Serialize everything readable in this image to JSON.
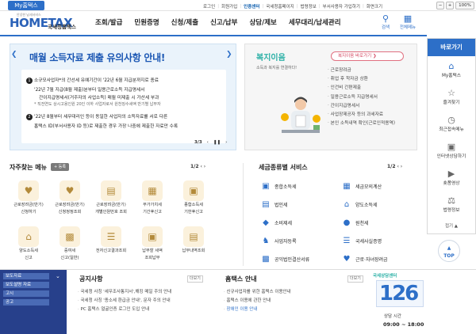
{
  "topbar": {
    "mytab_label": "My홈택스",
    "links": [
      "로그인",
      "회원가입",
      "인증센터",
      "국세청홈페이지",
      "법령정보",
      "부서사용자 가입하기",
      "화면크기"
    ],
    "zoom": "100%"
  },
  "header": {
    "logo_sub": "안녕한 납세서비스",
    "logo_main": "HOMETAX",
    "logo_kor": "국세청홈택스",
    "gnb": [
      "조회/발급",
      "민원증명",
      "신청/제출",
      "신고/납부",
      "상담/제보",
      "세무대리/납세관리"
    ],
    "search_label": "검색",
    "allmenu_label": "전체메뉴"
  },
  "banner": {
    "title": "매월 소득자료 제출 유의사항 안내!",
    "line1": "소규모사업자*의 간선세 유예기간이 '22년 6월 지급분까지로 종료",
    "line2": "'22년 7월 지급(8월 제출)분부터 일용근로소득 지급명세서",
    "line3": "간이지급명세서(거주자의 사업소득) 매월 미제출 시 가산세 부과",
    "line4": "* 직전연도 상시고용인원 20인 이하 사업자로서 원천징수세액 반기별 납부자",
    "line5": "'22년 8월부터 세무대리인 등이 동일한 사업자의 소득자료를 서로 다른",
    "line6": "홈택스 ID(부서사용자 ID 등)로 제출한 경우 가장 나중에 제출한 자료만 수록",
    "page": "3/3"
  },
  "welfare": {
    "title": "복지이음",
    "desc1": "소득과 복지를 연결하다!",
    "desc2": "",
    "button": "복지이음 바로가기",
    "items": [
      "근로장려금",
      "취업 후 학자금 상환",
      "인건비 간편제출",
      "일용근로소득 지급명세서",
      "간이지급명세서",
      "사업장제공자 등의 과세자료",
      "본인 소득내역 확인(근로인적용역)"
    ]
  },
  "quick": {
    "title": "바로가기",
    "items": [
      "My홈택스",
      "즐겨찾기",
      "최근접속메뉴",
      "인터넷상담하기",
      "숏폼영상",
      "법령정보"
    ],
    "more": "접기"
  },
  "top_button": "TOP",
  "favorites": {
    "title": "자주찾는 메뉴",
    "register": "등록",
    "page": "1/2",
    "items": [
      [
        "근로장려금(반기)",
        "신청하기"
      ],
      [
        "근로장려금(반기)",
        "신청정정조회"
      ],
      [
        "근로장려금(반기)",
        "개별인원번호 조회"
      ],
      [
        "부가가치세",
        "기간후신고"
      ],
      [
        "종합소득세",
        "기한후신고"
      ],
      [
        "양도소득세",
        "신고"
      ],
      [
        "증여세",
        "신고(일반)"
      ],
      [
        "전자신고결과조회",
        ""
      ],
      [
        "납부할 세액",
        "조회납부"
      ],
      [
        "납부내역조회",
        ""
      ]
    ]
  },
  "tax_services": {
    "title": "세금종류별 서비스",
    "page": "1/2",
    "items": [
      "종합소득세",
      "세금모의계산",
      "법인세",
      "양도소득세",
      "소비제세",
      "원천세",
      "사업자등록",
      "국세사실증명",
      "공익법인결산서류",
      "근로·자녀장려금"
    ]
  },
  "bottom_links": [
    "보도자료",
    "보도설명 자료",
    "고시",
    "공고"
  ],
  "notices": {
    "title": "공지사항",
    "more": "더보기",
    "items": [
      "국세청 사칭 '세무조사통지서',해킹 메일 주의 안내",
      "국세청 사칭 '종소세 환급금 안내', 문자 주의 안내",
      "PC 홈택스 얼굴인증 로그인 도입 안내"
    ]
  },
  "hometax_guide": {
    "title": "홈택스 안내",
    "more": "더보기",
    "items": [
      "신규사업자를 위한 홈택스 이용안내",
      "홈택스 이용에 관한 안내",
      "장애인 이용 안내"
    ]
  },
  "callcenter": {
    "head": "국세상담센터",
    "number": "126",
    "label": "상담 시간",
    "hours": "09:00 ~ 18:00"
  },
  "colors": {
    "brand": "#2d6fc8",
    "welfare": "#2bb0a6",
    "navy": "#27408b"
  }
}
